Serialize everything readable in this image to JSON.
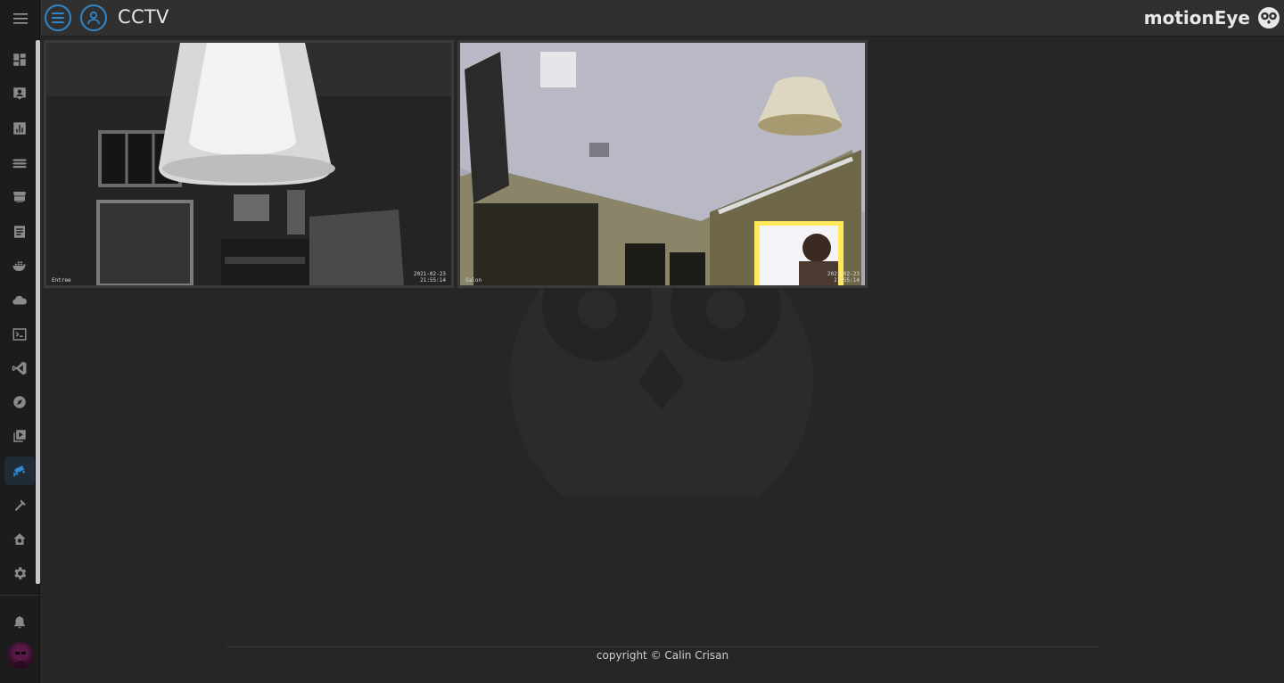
{
  "header": {
    "title": "CCTV",
    "brand": "motionEye"
  },
  "sidebar": {
    "items": [
      {
        "name": "overview",
        "icon": "dashboard-icon"
      },
      {
        "name": "map",
        "icon": "account-box-icon"
      },
      {
        "name": "energy",
        "icon": "chart-icon"
      },
      {
        "name": "logbook",
        "icon": "memory-icon"
      },
      {
        "name": "hacs",
        "icon": "store-icon"
      },
      {
        "name": "history",
        "icon": "notes-icon"
      },
      {
        "name": "portainer",
        "icon": "docker-icon"
      },
      {
        "name": "cloud",
        "icon": "cloud-icon"
      },
      {
        "name": "terminal",
        "icon": "terminal-icon"
      },
      {
        "name": "vscode",
        "icon": "vscode-icon"
      },
      {
        "name": "browser",
        "icon": "compass-icon"
      },
      {
        "name": "media",
        "icon": "play-box-icon"
      },
      {
        "name": "cctv",
        "icon": "cctv-icon",
        "active": true
      },
      {
        "name": "developer-tools",
        "icon": "hammer-icon"
      },
      {
        "name": "supervisor",
        "icon": "home-gear-icon"
      },
      {
        "name": "settings",
        "icon": "gear-icon"
      }
    ],
    "notifications_icon": "bell-icon"
  },
  "cameras": [
    {
      "label": "Entree",
      "timestamp_date": "2021-02-23",
      "timestamp_time": "21:55:14"
    },
    {
      "label": "Salon",
      "timestamp_date": "2021-02-23",
      "timestamp_time": "21:55:14"
    }
  ],
  "footer": {
    "copyright": "copyright © Calin Crisan"
  },
  "colors": {
    "accent": "#2f86c8",
    "background": "#262626",
    "topbar": "#303030",
    "sidebar": "#1c1c1c"
  }
}
